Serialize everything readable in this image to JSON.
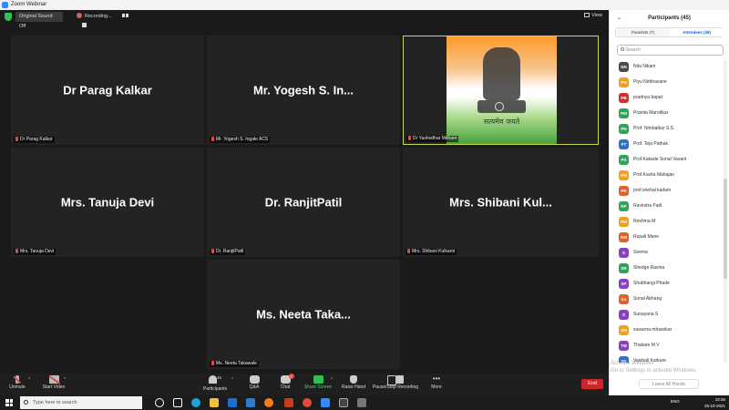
{
  "window": {
    "title": "Zoom Webinar"
  },
  "topbar": {
    "original_sound": "Original Sound: Off",
    "recording": "Recording...",
    "view": "View"
  },
  "tiles": [
    {
      "big": "Dr Parag Kalkar",
      "name": "Dr Parag Kalkar"
    },
    {
      "big": "Mr. Yogesh S. In...",
      "name": "Mr. Yogesh S. Ingale ACS"
    },
    {
      "big": "",
      "name": "Dr Yashodhar Mithare",
      "motto": "सत्यमेव जयते"
    },
    {
      "big": "Mrs. Tanuja Devi",
      "name": "Mrs. Tanuja Devi"
    },
    {
      "big": "Dr. RanjitPatil",
      "name": "Dr. RanjitPatil"
    },
    {
      "big": "Mrs. Shibani Kul...",
      "name": "Mrs. Shibani Kulkarni"
    },
    {
      "big": "Ms. Neeta Taka...",
      "name": "Ms. Neeta Takawale"
    }
  ],
  "toolbar": {
    "unmute": "Unmute",
    "start_video": "Start Video",
    "participants_count": "45",
    "participants": "Participants",
    "qa": "Q&A",
    "chat": "Chat",
    "chat_badge": "1",
    "share_screen": "Share Screen",
    "raise_hand": "Raise Hand",
    "pause_recording": "Pause/Stop Recording",
    "more": "More",
    "end": "End"
  },
  "panel": {
    "title": "Participants (45)",
    "tab_panelists": "Panelists (7)",
    "tab_attendees": "Attendees (38)",
    "search_placeholder": "Search",
    "leave_all": "Leave All Hands",
    "attendees": [
      {
        "initials": "NN",
        "name": "Nita Nikam",
        "color": "#4a4a4a"
      },
      {
        "initials": "PN",
        "name": "Piyu Nirbhavane",
        "color": "#f0a020"
      },
      {
        "initials": "PB",
        "name": "pradnya bapat",
        "color": "#d03030"
      },
      {
        "initials": "PM",
        "name": "Pranita Marodkar",
        "color": "#2fa35a"
      },
      {
        "initials": "PN",
        "name": "Prof. Nimbalkar S.S.",
        "color": "#2fa35a"
      },
      {
        "initials": "PT",
        "name": "Prof. Teja Pathak",
        "color": "#2f6fd0"
      },
      {
        "initials": "PS",
        "name": "Prof.Kakade Sonal Vasant",
        "color": "#2fa35a"
      },
      {
        "initials": "PM",
        "name": "Prof.Kavita Mahajan",
        "color": "#f0a020"
      },
      {
        "initials": "PK",
        "name": "prof.snehal kadam",
        "color": "#e2602a"
      },
      {
        "initials": "RP",
        "name": "Ravindra Patil",
        "color": "#2fa35a"
      },
      {
        "initials": "RM",
        "name": "Reshma M",
        "color": "#f0a020"
      },
      {
        "initials": "RM",
        "name": "Rupali Mane",
        "color": "#e2602a"
      },
      {
        "initials": "S",
        "name": "Seema",
        "color": "#8a3fc0"
      },
      {
        "initials": "SR",
        "name": "Shedge Ravina",
        "color": "#2fa35a"
      },
      {
        "initials": "SP",
        "name": "Shubhangi Phade",
        "color": "#8a3fc0"
      },
      {
        "initials": "SA",
        "name": "Sonal Abhang",
        "color": "#e2602a"
      },
      {
        "initials": "S",
        "name": "Sunayana S",
        "color": "#8a3fc0"
      },
      {
        "initials": "SM",
        "name": "suwarna mhasekar",
        "color": "#f0a020"
      },
      {
        "initials": "TM",
        "name": "Thakare M V",
        "color": "#8a3fc0"
      },
      {
        "initials": "VK",
        "name": "Vaishali Karkare",
        "color": "#2f6fd0"
      }
    ]
  },
  "activate_windows": {
    "line1": "Activate Windows",
    "line2": "Go to Settings to activate Windows."
  },
  "taskbar": {
    "search_placeholder": "Type here to search",
    "lang": "ENG",
    "time": "10:35",
    "date": "25-10-2021"
  }
}
